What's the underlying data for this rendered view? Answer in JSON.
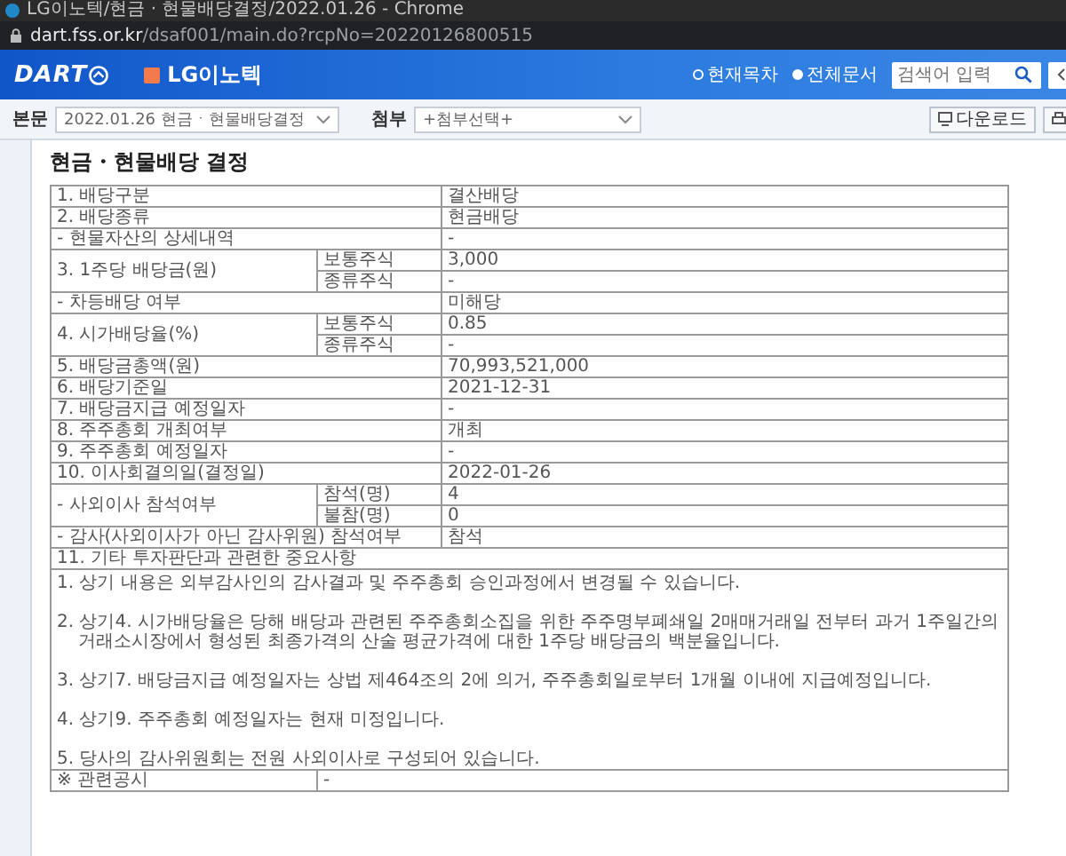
{
  "window": {
    "title": "LG이노텍/현금 · 현물배당결정/2022.01.26 - Chrome",
    "url_host": "dart.fss.or.kr",
    "url_path": "/dsaf001/main.do?rcpNo=20220126800515"
  },
  "header": {
    "logo": "DART",
    "company": "LG이노텍",
    "scopes": [
      {
        "label": "현재목차",
        "selected": false
      },
      {
        "label": "전체문서",
        "selected": true
      }
    ],
    "search": {
      "placeholder": "검색어 입력"
    }
  },
  "toolbar": {
    "body_label": "본문",
    "body_select": "2022.01.26  현금ㆍ현물배당결정",
    "attach_label": "첨부",
    "attach_select": "+첨부선택+",
    "download": "다운로드"
  },
  "document": {
    "title": "현금・현물배당 결정",
    "rows": [
      {
        "kind": "single",
        "label": "1. 배당구분",
        "value": "결산배당"
      },
      {
        "kind": "single",
        "label": "2. 배당종류",
        "value": "현금배당"
      },
      {
        "kind": "single",
        "label": "- 현물자산의 상세내역",
        "value": "-"
      },
      {
        "kind": "split",
        "label": "3. 1주당 배당금(원)",
        "subs": [
          {
            "label": "보통주식",
            "value": "3,000"
          },
          {
            "label": "종류주식",
            "value": "-"
          }
        ]
      },
      {
        "kind": "single",
        "label": "- 차등배당 여부",
        "value": "미해당"
      },
      {
        "kind": "split",
        "label": "4. 시가배당율(%)",
        "subs": [
          {
            "label": "보통주식",
            "value": "0.85"
          },
          {
            "label": "종류주식",
            "value": "-"
          }
        ]
      },
      {
        "kind": "single",
        "label": "5. 배당금총액(원)",
        "value": "70,993,521,000"
      },
      {
        "kind": "single",
        "label": "6. 배당기준일",
        "value": "2021-12-31"
      },
      {
        "kind": "single",
        "label": "7. 배당금지급 예정일자",
        "value": "-"
      },
      {
        "kind": "single",
        "label": "8. 주주총회 개최여부",
        "value": "개최"
      },
      {
        "kind": "single",
        "label": "9. 주주총회 예정일자",
        "value": "-"
      },
      {
        "kind": "single",
        "label": "10. 이사회결의일(결정일)",
        "value": "2022-01-26"
      },
      {
        "kind": "split",
        "label": "- 사외이사 참석여부",
        "subs": [
          {
            "label": "참석(명)",
            "value": "4"
          },
          {
            "label": "불참(명)",
            "value": "0"
          }
        ]
      },
      {
        "kind": "single",
        "label": "- 감사(사외이사가 아닌 감사위원) 참석여부",
        "value": "참석"
      },
      {
        "kind": "section",
        "label": "11. 기타 투자판단과 관련한 중요사항"
      },
      {
        "kind": "notes",
        "lines": [
          "1. 상기 내용은 외부감사인의 감사결과 및 주주총회 승인과정에서 변경될 수 있습니다.",
          "2. 상기4. 시가배당율은 당해 배당과 관련된 주주총회소집을 위한 주주명부폐쇄일 2매매거래일 전부터 과거 1주일간의 거래소시장에서 형성된 최종가격의 산술 평균가격에 대한 1주당 배당금의 백분율입니다.",
          "3. 상기7. 배당금지급 예정일자는 상법 제464조의 2에 의거, 주주총회일로부터 1개월 이내에 지급예정입니다.",
          "4. 상기9. 주주총회 예정일자는 현재 미정입니다.",
          "5. 당사의 감사위원회는 전원 사외이사로 구성되어 있습니다."
        ]
      },
      {
        "kind": "related",
        "label": "※ 관련공시",
        "value": "-"
      }
    ]
  }
}
